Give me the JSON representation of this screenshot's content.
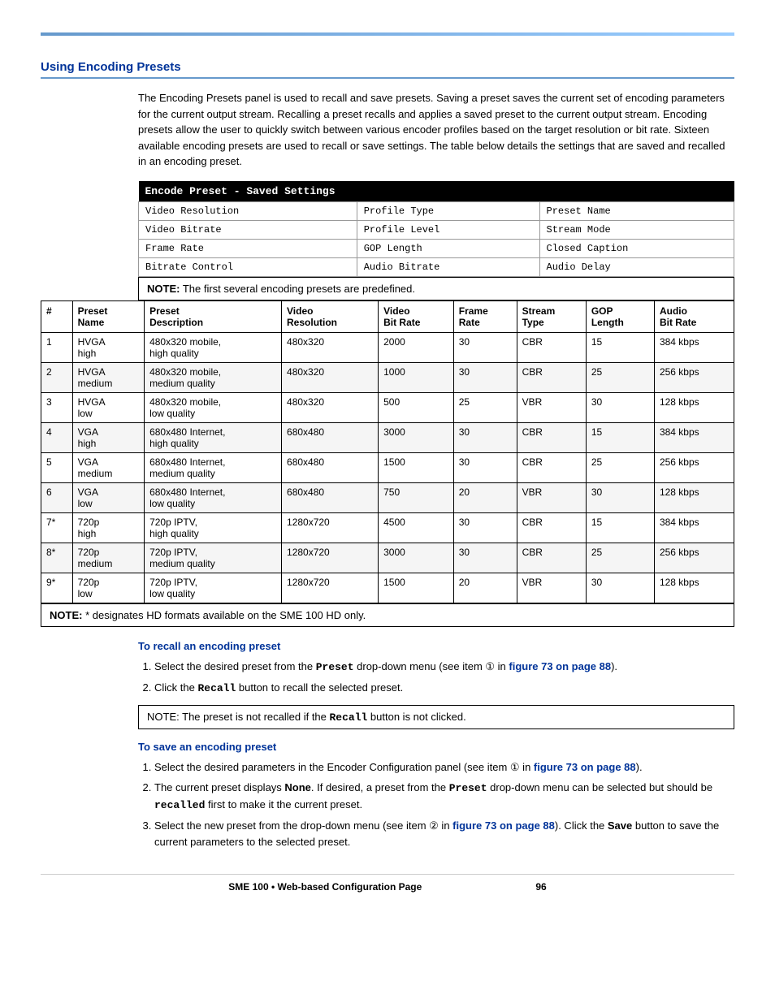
{
  "topBar": {},
  "section": {
    "title": "Using Encoding Presets"
  },
  "intro": {
    "text": "The Encoding Presets panel is used to recall and save presets. Saving a preset saves the current set of encoding parameters for the current output stream. Recalling a preset recalls and applies a saved preset to the current output stream. Encoding presets allow the user to quickly switch between various encoder profiles based on the target resolution or bit rate. Sixteen available encoding presets are used to recall or save settings. The table below details the settings that are saved and recalled in an encoding preset."
  },
  "savedSettingsTable": {
    "header": "Encode Preset - Saved Settings",
    "rows": [
      [
        "Video Resolution",
        "Profile Type",
        "Preset Name"
      ],
      [
        "Video Bitrate",
        "Profile Level",
        "Stream Mode"
      ],
      [
        "Frame Rate",
        "GOP Length",
        "Closed Caption"
      ],
      [
        "Bitrate Control",
        "Audio Bitrate",
        "Audio Delay"
      ]
    ]
  },
  "notePredef": {
    "label": "NOTE:",
    "text": "The first several encoding presets are predefined."
  },
  "presetsTable": {
    "headers": [
      "#",
      "Preset\nName",
      "Preset\nDescription",
      "Video\nResolution",
      "Video\nBit Rate",
      "Frame\nRate",
      "Stream\nType",
      "GOP\nLength",
      "Audio\nBit Rate"
    ],
    "rows": [
      {
        "num": "1",
        "name": "HVGA\nhigh",
        "desc": "480x320 mobile,\nhigh quality",
        "res": "480x320",
        "vbr": "2000",
        "fr": "30",
        "st": "CBR",
        "gop": "15",
        "abr": "384 kbps"
      },
      {
        "num": "2",
        "name": "HVGA\nmedium",
        "desc": "480x320 mobile,\nmedium quality",
        "res": "480x320",
        "vbr": "1000",
        "fr": "30",
        "st": "CBR",
        "gop": "25",
        "abr": "256 kbps"
      },
      {
        "num": "3",
        "name": "HVGA\nlow",
        "desc": "480x320 mobile,\nlow quality",
        "res": "480x320",
        "vbr": "500",
        "fr": "25",
        "st": "VBR",
        "gop": "30",
        "abr": "128 kbps"
      },
      {
        "num": "4",
        "name": "VGA\nhigh",
        "desc": "680x480 Internet,\nhigh quality",
        "res": "680x480",
        "vbr": "3000",
        "fr": "30",
        "st": "CBR",
        "gop": "15",
        "abr": "384 kbps"
      },
      {
        "num": "5",
        "name": "VGA\nmedium",
        "desc": "680x480 Internet,\nmedium quality",
        "res": "680x480",
        "vbr": "1500",
        "fr": "30",
        "st": "CBR",
        "gop": "25",
        "abr": "256 kbps"
      },
      {
        "num": "6",
        "name": "VGA\nlow",
        "desc": "680x480 Internet,\nlow quality",
        "res": "680x480",
        "vbr": "750",
        "fr": "20",
        "st": "VBR",
        "gop": "30",
        "abr": "128 kbps"
      },
      {
        "num": "7*",
        "name": "720p\nhigh",
        "desc": "720p IPTV,\nhigh quality",
        "res": "1280x720",
        "vbr": "4500",
        "fr": "30",
        "st": "CBR",
        "gop": "15",
        "abr": "384 kbps"
      },
      {
        "num": "8*",
        "name": "720p\nmedium",
        "desc": "720p IPTV,\nmedium quality",
        "res": "1280x720",
        "vbr": "3000",
        "fr": "30",
        "st": "CBR",
        "gop": "25",
        "abr": "256 kbps"
      },
      {
        "num": "9*",
        "name": "720p\nlow",
        "desc": "720p IPTV,\nlow quality",
        "res": "1280x720",
        "vbr": "1500",
        "fr": "20",
        "st": "VBR",
        "gop": "30",
        "abr": "128 kbps"
      }
    ]
  },
  "noteHD": {
    "label": "NOTE:",
    "text": "* designates HD formats available on the SME 100 HD only."
  },
  "recallSection": {
    "title": "To recall an encoding preset",
    "steps": [
      {
        "id": 1,
        "text_before": "Select the desired preset from the ",
        "code": "Preset",
        "text_middle": " drop-down menu (see item ① in ",
        "link": "figure 73 on page 88",
        "text_after": ")."
      },
      {
        "id": 2,
        "text_before": "Click the ",
        "code": "Recall",
        "text_after": " button to recall the selected preset."
      }
    ],
    "note": {
      "label": "NOTE:",
      "text_before": "The preset is not recalled if the ",
      "code": "Recall",
      "text_after": " button is not clicked."
    }
  },
  "saveSection": {
    "title": "To save an encoding preset",
    "steps": [
      {
        "id": 1,
        "text_before": "Select the desired parameters in the Encoder Configuration panel (see item ① in ",
        "link": "figure 73 on page 88",
        "text_after": ")."
      },
      {
        "id": 2,
        "text_before": "The current preset displays ",
        "bold1": "None",
        "text_middle": ". If desired, a preset from the ",
        "code": "Preset",
        "text_middle2": " drop-down menu can be selected but should be ",
        "code2": "recalled",
        "text_after": " first to make it the current preset."
      },
      {
        "id": 3,
        "text_before": "Select the new preset from the drop-down menu (see item ② in ",
        "link": "figure 73 on page 88",
        "text_middle": "). Click the ",
        "bold": "Save",
        "text_after": " button to save the current parameters to the selected preset."
      }
    ]
  },
  "footer": {
    "text": "SME 100 • Web-based Configuration Page",
    "page": "96"
  }
}
